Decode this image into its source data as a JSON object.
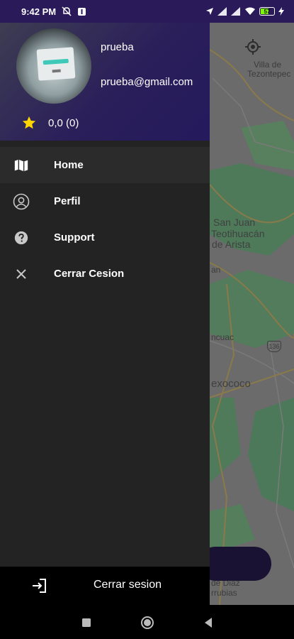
{
  "status_bar": {
    "time": "9:42 PM",
    "battery": "57"
  },
  "map": {
    "labels": {
      "villa": "Villa de",
      "tezontepec": "Tezontepec",
      "san_juan": "San Juan",
      "teotihuacan": "Teotihuacán",
      "de_arista": "de Arista",
      "an": "an",
      "ncuac": "ncuac",
      "route": "136",
      "texcoco": "exococo",
      "de_diaz": "de Diaz",
      "rrubias": "rrubias"
    }
  },
  "drawer": {
    "profile": {
      "name": "prueba",
      "email": "prueba@gmail.com",
      "rating": "0,0 (0)"
    },
    "menu": [
      {
        "label": "Home",
        "icon": "map-icon"
      },
      {
        "label": "Perfil",
        "icon": "person-icon"
      },
      {
        "label": "Support",
        "icon": "help-icon"
      },
      {
        "label": "Cerrar Cesion",
        "icon": "close-icon"
      }
    ],
    "footer": {
      "label": "Cerrar sesion",
      "icon": "logout-icon"
    }
  },
  "colors": {
    "header": "#2b1f5a",
    "drawer_bg": "#232323",
    "star": "#ffd600",
    "map_bg": "#6b6b6b"
  }
}
